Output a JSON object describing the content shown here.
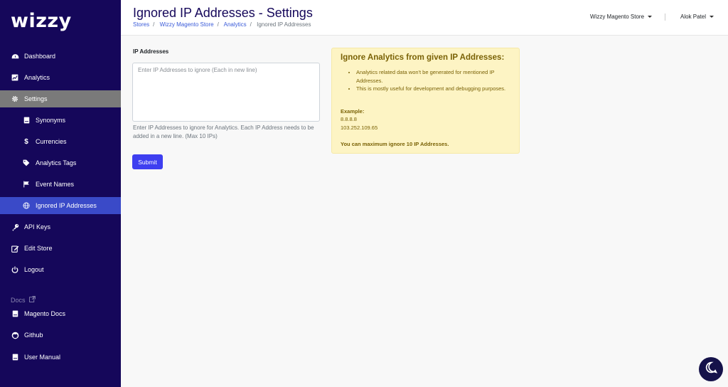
{
  "app": {
    "logo": "wizzy"
  },
  "sidebar": {
    "items": [
      {
        "label": "Dashboard",
        "icon": "dashboard-icon"
      },
      {
        "label": "Analytics",
        "icon": "chart-icon"
      },
      {
        "label": "Settings",
        "icon": "gear-icon"
      },
      {
        "label": "Synonyms",
        "icon": "book-icon"
      },
      {
        "label": "Currencies",
        "icon": "dollar-icon"
      },
      {
        "label": "Analytics Tags",
        "icon": "tag-icon"
      },
      {
        "label": "Event Names",
        "icon": "flag-icon"
      },
      {
        "label": "Ignored IP Addresses",
        "icon": "globe-icon"
      },
      {
        "label": "API Keys",
        "icon": "key-icon"
      },
      {
        "label": "Edit Store",
        "icon": "edit-icon"
      },
      {
        "label": "Logout",
        "icon": "power-icon"
      }
    ],
    "docs_label": "Docs",
    "docs_items": [
      {
        "label": "Magento Docs",
        "icon": "book-icon"
      },
      {
        "label": "Github",
        "icon": "github-icon"
      },
      {
        "label": "User Manual",
        "icon": "book-icon"
      }
    ]
  },
  "header": {
    "title": "Ignored IP Addresses - Settings",
    "breadcrumb": [
      "Stores",
      "Wizzy Magento Store",
      "Analytics",
      "Ignored IP Addresses"
    ],
    "store_selector": "Wizzy Magento Store",
    "user_menu": "Alok Patel"
  },
  "form": {
    "label": "IP Addresses",
    "placeholder": "Enter IP Addresses to ignore (Each in new line)",
    "value": "",
    "help": "Enter IP Addresses to ignore for Analytics. Each IP Address needs to be added in a new line. (Max 10 IPs)",
    "submit_label": "Submit",
    "submit_color": "#3e3ff0"
  },
  "info": {
    "title": "Ignore Analytics from given IP Addresses:",
    "bullets": [
      "Analytics related data won't be generated for mentioned IP Addresses.",
      "This is mostly useful for development and debugging purposes."
    ],
    "example_label": "Example:",
    "examples": [
      "8.8.8.8",
      "103.252.109.65"
    ],
    "max_note": "You can maximum ignore 10 IP Addresses.",
    "bg_color": "#fdf4c4",
    "text_color": "#7a6206"
  },
  "colors": {
    "sidebar_bg": "#15075a",
    "active_item": "#3a4ac8",
    "active_parent": "#7a7a7a"
  },
  "chat": {
    "icon": "chat-icon"
  }
}
